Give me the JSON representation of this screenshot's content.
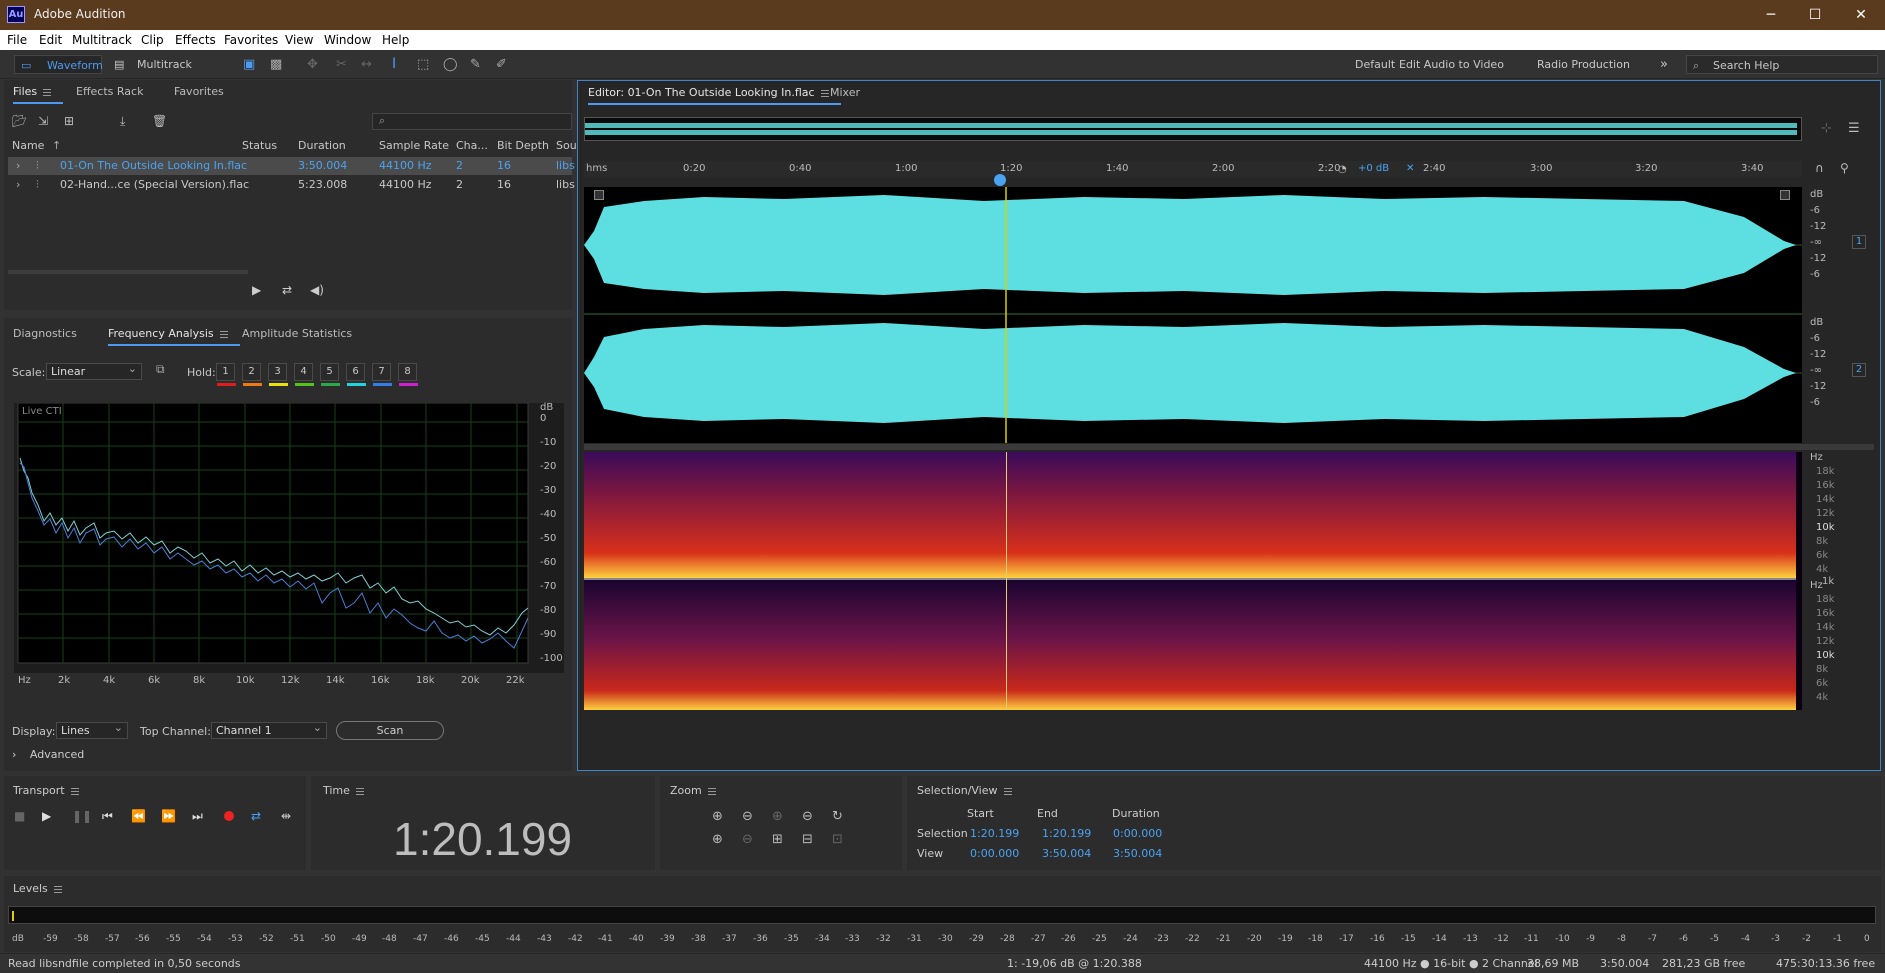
{
  "app": {
    "title": "Adobe Audition",
    "logo": "Au"
  },
  "window_controls": {
    "minimize": "─",
    "maximize": "☐",
    "close": "✕"
  },
  "menu": [
    "File",
    "Edit",
    "Multitrack",
    "Clip",
    "Effects",
    "Favorites",
    "View",
    "Window",
    "Help"
  ],
  "toolbar": {
    "waveform": "Waveform",
    "multitrack": "Multitrack",
    "workspaces": [
      "Default",
      "Edit Audio to Video",
      "Radio Production"
    ],
    "more": "»",
    "search_placeholder": "Search Help"
  },
  "files_panel": {
    "tabs": [
      "Files",
      "Effects Rack",
      "Favorites"
    ],
    "columns": [
      "Name",
      "Status",
      "Duration",
      "Sample Rate",
      "Cha...",
      "Bit Depth",
      "Sou"
    ],
    "rows": [
      {
        "name": "01-On The Outside Looking In.flac",
        "duration": "3:50.004",
        "rate": "44100 Hz",
        "ch": "2",
        "depth": "16",
        "src": "libs"
      },
      {
        "name": "02-Hand...ce (Special Version).flac",
        "duration": "5:23.008",
        "rate": "44100 Hz",
        "ch": "2",
        "depth": "16",
        "src": "libs"
      }
    ]
  },
  "freq_panel": {
    "tabs": [
      "Diagnostics",
      "Frequency Analysis",
      "Amplitude Statistics"
    ],
    "scale_label": "Scale:",
    "scale_value": "Linear",
    "hold_label": "Hold:",
    "hold_buttons": [
      "1",
      "2",
      "3",
      "4",
      "5",
      "6",
      "7",
      "8"
    ],
    "hold_colors": [
      "#e21b1b",
      "#ee7a11",
      "#e8e010",
      "#51c51c",
      "#2aa84a",
      "#1fd3e0",
      "#2f7fe6",
      "#d01fd0"
    ],
    "live_label": "Live CTI",
    "db_ticks": [
      "dB",
      "0",
      "-10",
      "-20",
      "-30",
      "-40",
      "-50",
      "-60",
      "-70",
      "-80",
      "-90",
      "-100"
    ],
    "hz_ticks": [
      "Hz",
      "2k",
      "4k",
      "6k",
      "8k",
      "10k",
      "12k",
      "14k",
      "16k",
      "18k",
      "20k",
      "22k"
    ],
    "display_label": "Display:",
    "display_value": "Lines",
    "top_channel_label": "Top Channel:",
    "top_channel_value": "Channel 1",
    "scan_label": "Scan",
    "advanced_label": "Advanced"
  },
  "editor": {
    "tab": "Editor: 01-On The Outside Looking In.flac",
    "mixer_tab": "Mixer",
    "ruler": [
      "hms",
      "0:20",
      "0:40",
      "1:00",
      "1:20",
      "1:40",
      "2:00",
      "2:20",
      "2:40",
      "3:00",
      "3:20",
      "3:40"
    ],
    "gain": "+0 dB",
    "amp_scale": [
      "dB",
      "-6",
      "-12",
      "-∞",
      "-12",
      "-6"
    ],
    "channels": [
      "1",
      "2"
    ],
    "spec_scale": [
      "Hz",
      "18k",
      "16k",
      "14k",
      "12k",
      "10k",
      "8k",
      "6k",
      "4k",
      "1k"
    ]
  },
  "transport": {
    "title": "Transport"
  },
  "time": {
    "title": "Time",
    "value": "1:20.199"
  },
  "zoom": {
    "title": "Zoom"
  },
  "selection_view": {
    "title": "Selection/View",
    "headers": [
      "Start",
      "End",
      "Duration"
    ],
    "selection_label": "Selection",
    "selection": [
      "1:20.199",
      "1:20.199",
      "0:00.000"
    ],
    "view_label": "View",
    "view": [
      "0:00.000",
      "3:50.004",
      "3:50.004"
    ]
  },
  "levels": {
    "title": "Levels",
    "scale": [
      "dB",
      "-59",
      "-58",
      "-57",
      "-56",
      "-55",
      "-54",
      "-53",
      "-52",
      "-51",
      "-50",
      "-49",
      "-48",
      "-47",
      "-46",
      "-45",
      "-44",
      "-43",
      "-42",
      "-41",
      "-40",
      "-39",
      "-38",
      "-37",
      "-36",
      "-35",
      "-34",
      "-33",
      "-32",
      "-31",
      "-30",
      "-29",
      "-28",
      "-27",
      "-26",
      "-25",
      "-24",
      "-23",
      "-22",
      "-21",
      "-20",
      "-19",
      "-18",
      "-17",
      "-16",
      "-15",
      "-14",
      "-13",
      "-12",
      "-11",
      "-10",
      "-9",
      "-8",
      "-7",
      "-6",
      "-5",
      "-4",
      "-3",
      "-2",
      "-1",
      "0"
    ]
  },
  "status": {
    "left": "Read libsndfile completed in 0,50 seconds",
    "cursor": "1: -19,06 dB @ 1:20.388",
    "format": "44100 Hz ● 16-bit ● 2 Channel",
    "size": "38,69 MB",
    "duration": "3:50.004",
    "free": "281,23 GB free",
    "time_free": "475:30:13.36 free"
  }
}
